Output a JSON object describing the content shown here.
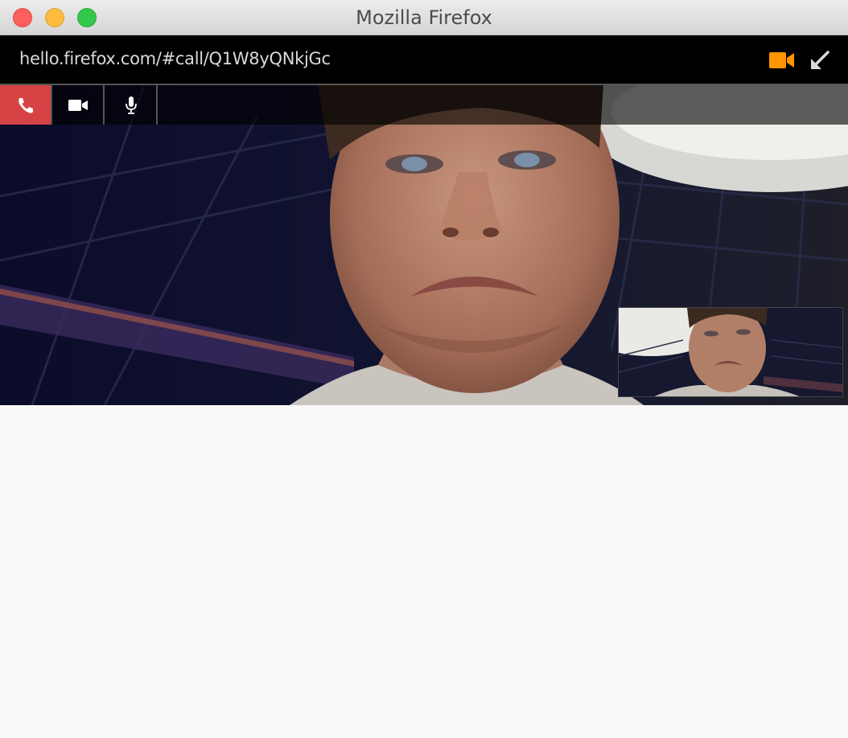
{
  "window": {
    "title": "Mozilla Firefox",
    "buttons": [
      "close",
      "minimize",
      "zoom"
    ]
  },
  "urlbar": {
    "url": "hello.firefox.com/#call/Q1W8yQNkjGc",
    "camera_indicator_icon": "video-camera-icon",
    "camera_indicator_color": "#ff9500",
    "expand_icon": "arrow-down-left-icon"
  },
  "call_controls": [
    {
      "name": "hangup",
      "icon": "phone-icon",
      "color": "#d74345"
    },
    {
      "name": "video",
      "icon": "video-camera-icon"
    },
    {
      "name": "microphone",
      "icon": "microphone-icon"
    }
  ],
  "colors": {
    "controls_bg": "#000000",
    "hangup": "#d74345",
    "camera_indicator": "#ff9500"
  }
}
